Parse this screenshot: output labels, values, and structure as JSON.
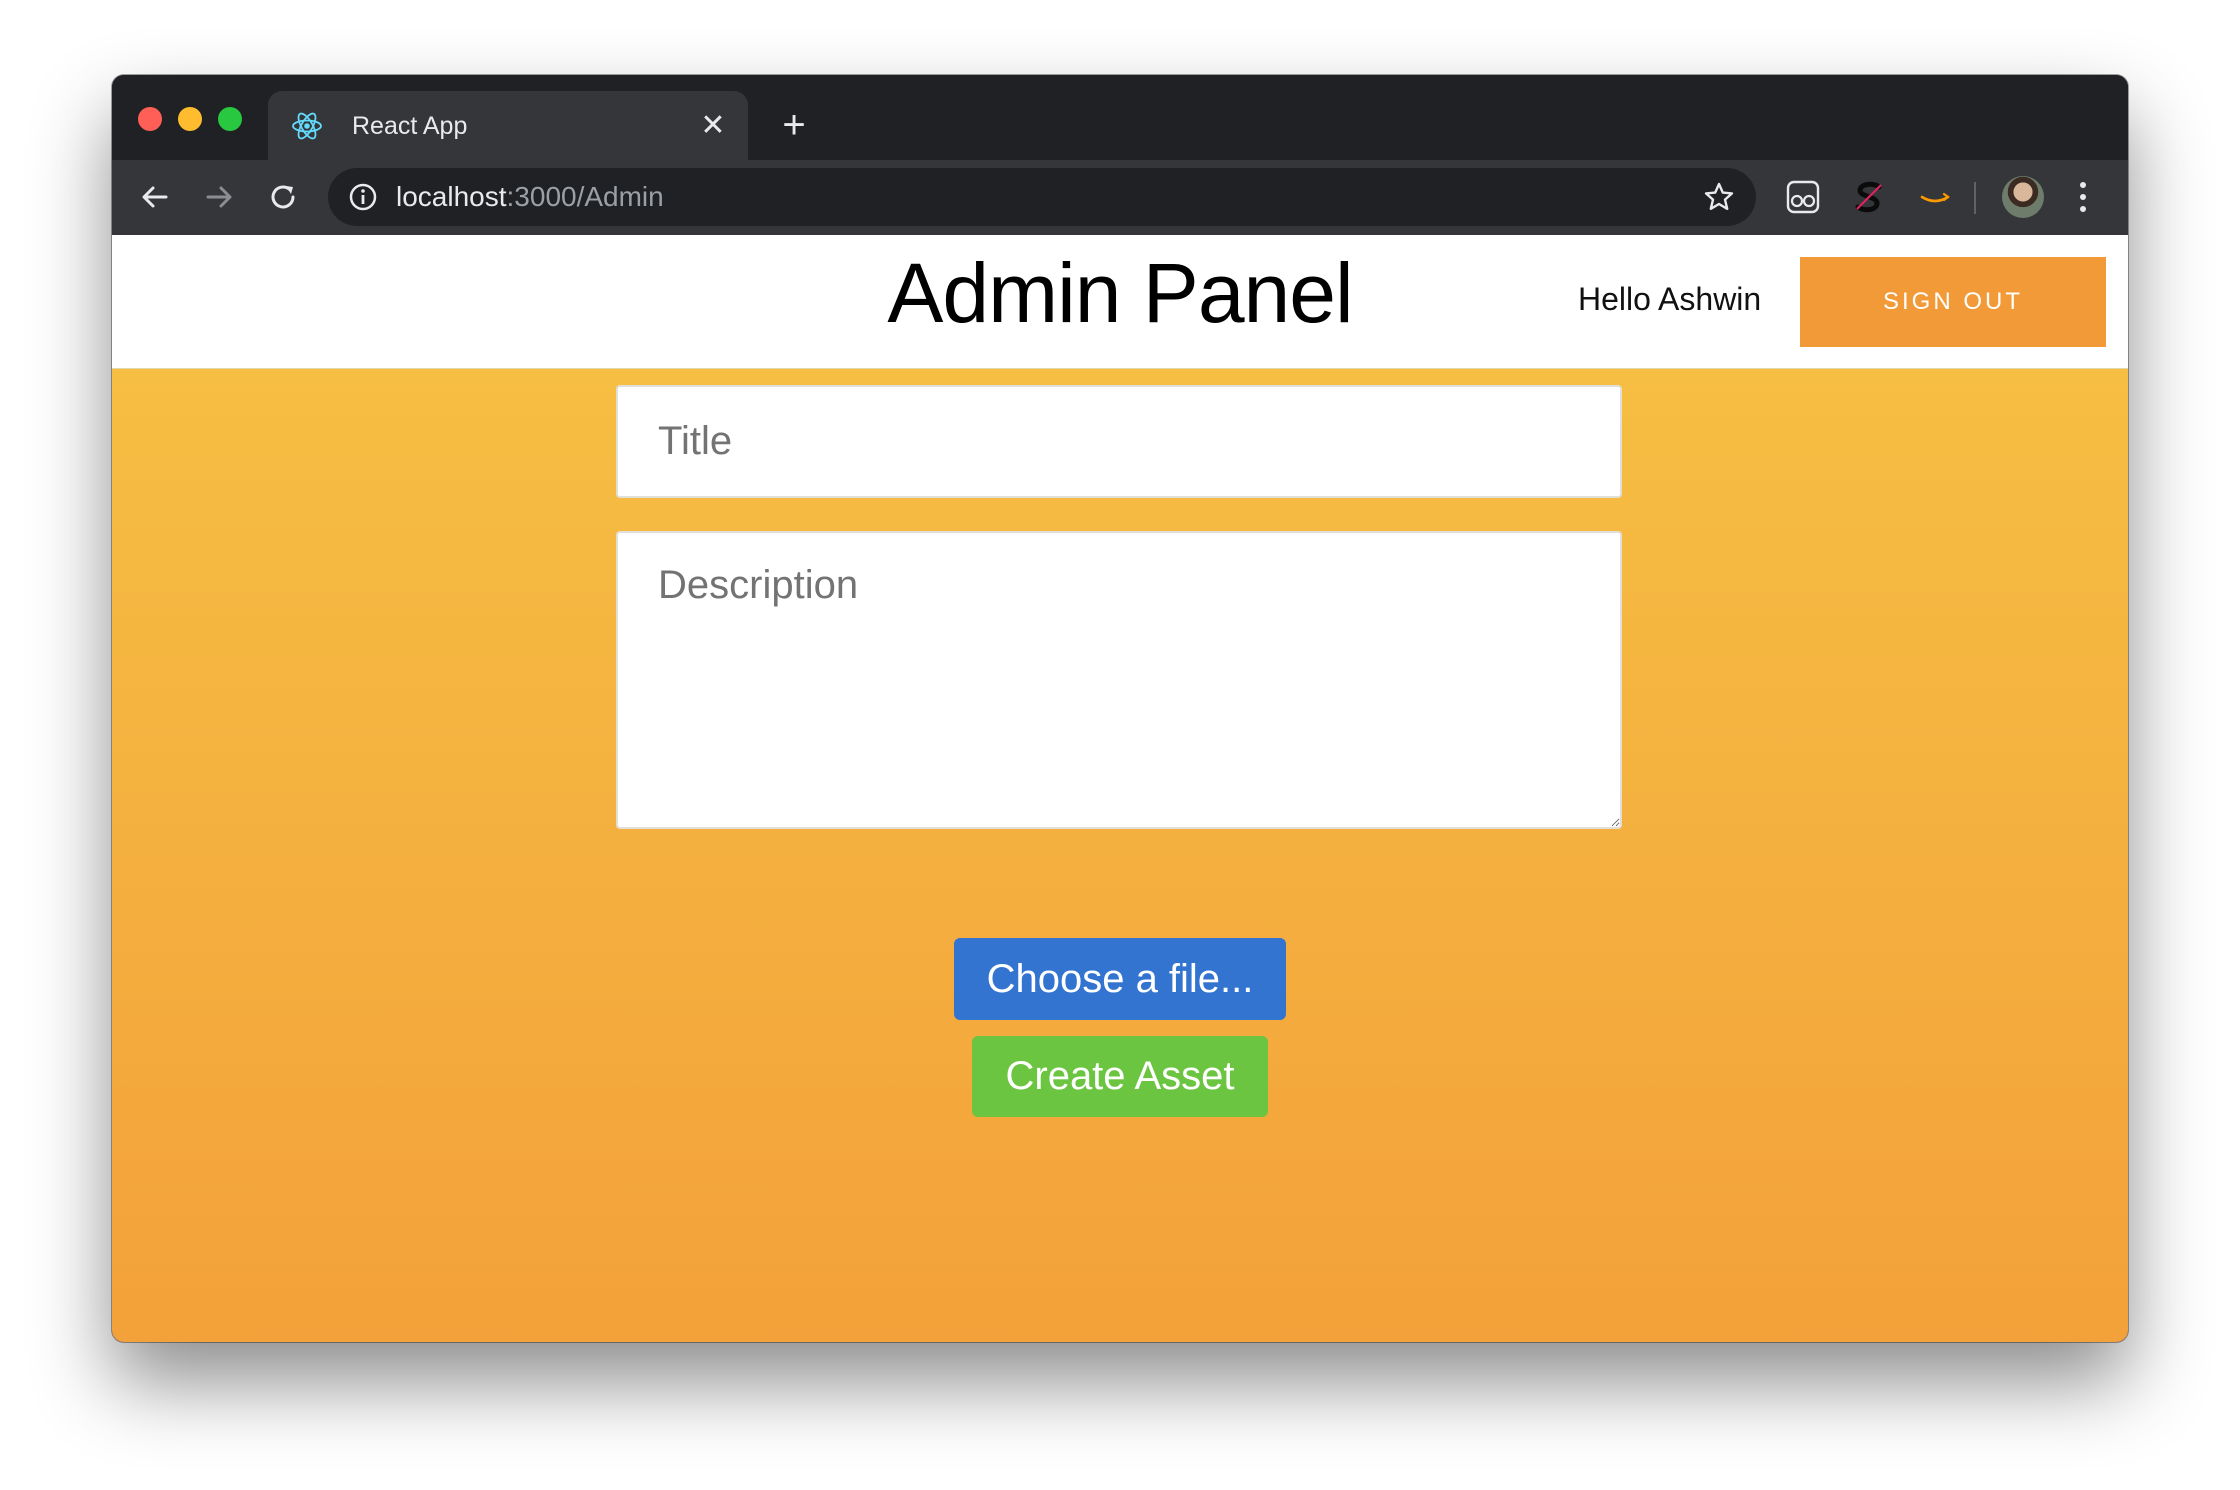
{
  "browser": {
    "tab": {
      "title": "React App",
      "close_glyph": "✕"
    },
    "new_tab_glyph": "+",
    "url_host": "localhost",
    "url_path": ":3000/Admin",
    "icons": [
      "back-icon",
      "forward-icon",
      "reload-icon",
      "info-icon",
      "star-icon",
      "reader-extension-icon",
      "s-extension-icon",
      "amazon-extension-icon",
      "profile-avatar",
      "menu-icon"
    ]
  },
  "header": {
    "title": "Admin Panel",
    "greeting": "Hello Ashwin",
    "signout_label": "SIGN OUT"
  },
  "form": {
    "title_placeholder": "Title",
    "description_placeholder": "Description",
    "file_button_label": "Choose a file...",
    "create_button_label": "Create Asset"
  },
  "colors": {
    "gradient_top": "#f6c244",
    "gradient_bottom": "#f3a13a",
    "signout_bg": "#f29a38",
    "file_button_bg": "#3274cf",
    "create_button_bg": "#6cc540"
  }
}
